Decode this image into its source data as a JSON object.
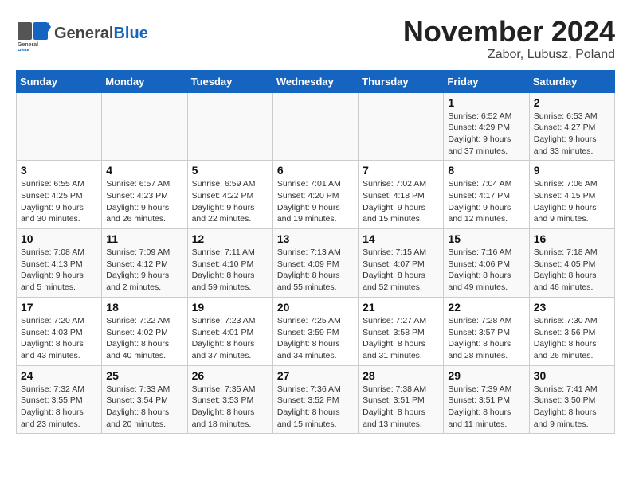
{
  "header": {
    "logo_general": "General",
    "logo_blue": "Blue",
    "month_title": "November 2024",
    "subtitle": "Zabor, Lubusz, Poland"
  },
  "days_of_week": [
    "Sunday",
    "Monday",
    "Tuesday",
    "Wednesday",
    "Thursday",
    "Friday",
    "Saturday"
  ],
  "weeks": [
    [
      {
        "day": "",
        "info": ""
      },
      {
        "day": "",
        "info": ""
      },
      {
        "day": "",
        "info": ""
      },
      {
        "day": "",
        "info": ""
      },
      {
        "day": "",
        "info": ""
      },
      {
        "day": "1",
        "info": "Sunrise: 6:52 AM\nSunset: 4:29 PM\nDaylight: 9 hours and 37 minutes."
      },
      {
        "day": "2",
        "info": "Sunrise: 6:53 AM\nSunset: 4:27 PM\nDaylight: 9 hours and 33 minutes."
      }
    ],
    [
      {
        "day": "3",
        "info": "Sunrise: 6:55 AM\nSunset: 4:25 PM\nDaylight: 9 hours and 30 minutes."
      },
      {
        "day": "4",
        "info": "Sunrise: 6:57 AM\nSunset: 4:23 PM\nDaylight: 9 hours and 26 minutes."
      },
      {
        "day": "5",
        "info": "Sunrise: 6:59 AM\nSunset: 4:22 PM\nDaylight: 9 hours and 22 minutes."
      },
      {
        "day": "6",
        "info": "Sunrise: 7:01 AM\nSunset: 4:20 PM\nDaylight: 9 hours and 19 minutes."
      },
      {
        "day": "7",
        "info": "Sunrise: 7:02 AM\nSunset: 4:18 PM\nDaylight: 9 hours and 15 minutes."
      },
      {
        "day": "8",
        "info": "Sunrise: 7:04 AM\nSunset: 4:17 PM\nDaylight: 9 hours and 12 minutes."
      },
      {
        "day": "9",
        "info": "Sunrise: 7:06 AM\nSunset: 4:15 PM\nDaylight: 9 hours and 9 minutes."
      }
    ],
    [
      {
        "day": "10",
        "info": "Sunrise: 7:08 AM\nSunset: 4:13 PM\nDaylight: 9 hours and 5 minutes."
      },
      {
        "day": "11",
        "info": "Sunrise: 7:09 AM\nSunset: 4:12 PM\nDaylight: 9 hours and 2 minutes."
      },
      {
        "day": "12",
        "info": "Sunrise: 7:11 AM\nSunset: 4:10 PM\nDaylight: 8 hours and 59 minutes."
      },
      {
        "day": "13",
        "info": "Sunrise: 7:13 AM\nSunset: 4:09 PM\nDaylight: 8 hours and 55 minutes."
      },
      {
        "day": "14",
        "info": "Sunrise: 7:15 AM\nSunset: 4:07 PM\nDaylight: 8 hours and 52 minutes."
      },
      {
        "day": "15",
        "info": "Sunrise: 7:16 AM\nSunset: 4:06 PM\nDaylight: 8 hours and 49 minutes."
      },
      {
        "day": "16",
        "info": "Sunrise: 7:18 AM\nSunset: 4:05 PM\nDaylight: 8 hours and 46 minutes."
      }
    ],
    [
      {
        "day": "17",
        "info": "Sunrise: 7:20 AM\nSunset: 4:03 PM\nDaylight: 8 hours and 43 minutes."
      },
      {
        "day": "18",
        "info": "Sunrise: 7:22 AM\nSunset: 4:02 PM\nDaylight: 8 hours and 40 minutes."
      },
      {
        "day": "19",
        "info": "Sunrise: 7:23 AM\nSunset: 4:01 PM\nDaylight: 8 hours and 37 minutes."
      },
      {
        "day": "20",
        "info": "Sunrise: 7:25 AM\nSunset: 3:59 PM\nDaylight: 8 hours and 34 minutes."
      },
      {
        "day": "21",
        "info": "Sunrise: 7:27 AM\nSunset: 3:58 PM\nDaylight: 8 hours and 31 minutes."
      },
      {
        "day": "22",
        "info": "Sunrise: 7:28 AM\nSunset: 3:57 PM\nDaylight: 8 hours and 28 minutes."
      },
      {
        "day": "23",
        "info": "Sunrise: 7:30 AM\nSunset: 3:56 PM\nDaylight: 8 hours and 26 minutes."
      }
    ],
    [
      {
        "day": "24",
        "info": "Sunrise: 7:32 AM\nSunset: 3:55 PM\nDaylight: 8 hours and 23 minutes."
      },
      {
        "day": "25",
        "info": "Sunrise: 7:33 AM\nSunset: 3:54 PM\nDaylight: 8 hours and 20 minutes."
      },
      {
        "day": "26",
        "info": "Sunrise: 7:35 AM\nSunset: 3:53 PM\nDaylight: 8 hours and 18 minutes."
      },
      {
        "day": "27",
        "info": "Sunrise: 7:36 AM\nSunset: 3:52 PM\nDaylight: 8 hours and 15 minutes."
      },
      {
        "day": "28",
        "info": "Sunrise: 7:38 AM\nSunset: 3:51 PM\nDaylight: 8 hours and 13 minutes."
      },
      {
        "day": "29",
        "info": "Sunrise: 7:39 AM\nSunset: 3:51 PM\nDaylight: 8 hours and 11 minutes."
      },
      {
        "day": "30",
        "info": "Sunrise: 7:41 AM\nSunset: 3:50 PM\nDaylight: 8 hours and 9 minutes."
      }
    ]
  ]
}
